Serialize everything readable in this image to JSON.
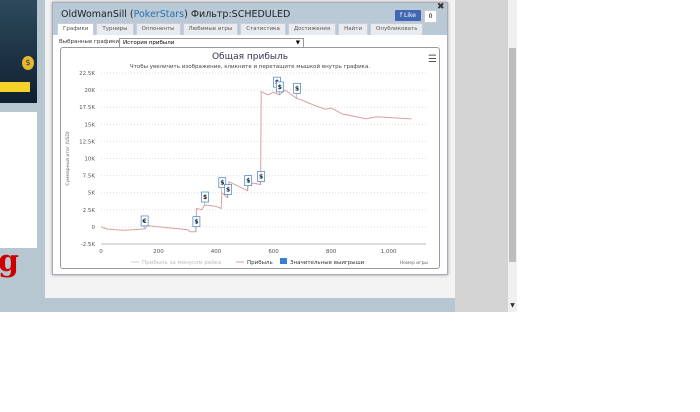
{
  "modal": {
    "user": "OldWomanSill",
    "site": "PokerStars",
    "filter": "Фильтр:SCHEDULED",
    "fb_like": "Like",
    "fb_count": "0"
  },
  "tabs": [
    "Графики",
    "Турниры",
    "Оппоненты",
    "Любимые игры",
    "Статистика",
    "Достижения",
    "Найти",
    "Опубликовать"
  ],
  "selector": {
    "label": "Выбранные графики:",
    "value": "История прибыли"
  },
  "chart_data": {
    "type": "line",
    "title": "Общая прибыль",
    "subtitle": "Чтобы увеличить изображение, кликните и перетащите мышкой внутрь графика.",
    "xlabel": "Номер игры",
    "ylabel": "Суммарный итог (USD)",
    "xlim": [
      0,
      1130
    ],
    "ylim": [
      -2500,
      22500
    ],
    "xticks": [
      "0",
      "200",
      "400",
      "600",
      "800",
      "1,000"
    ],
    "xtick_values": [
      0,
      200,
      400,
      600,
      800,
      1000
    ],
    "yticks": [
      "22.5K",
      "20K",
      "17.5K",
      "15K",
      "12.5K",
      "10K",
      "7.5K",
      "5K",
      "2.5K",
      "0",
      "-2.5K"
    ],
    "ytick_values": [
      22500,
      20000,
      17500,
      15000,
      12500,
      10000,
      7500,
      5000,
      2500,
      0,
      -2500
    ],
    "grid": true,
    "legend_position": "bottom",
    "legend": [
      "Прибыль за минусом рейка",
      "Прибыль",
      "Значительные выигрыши"
    ],
    "colors": {
      "profit": "#d9a0a0",
      "rake": "#cccccc",
      "flags": "#3a7fd5"
    },
    "series": [
      {
        "name": "Прибыль",
        "x": [
          0,
          20,
          80,
          150,
          155,
          160,
          200,
          300,
          310,
          330,
          332,
          350,
          360,
          400,
          418,
          420,
          440,
          445,
          460,
          500,
          510,
          512,
          555,
          557,
          580,
          600,
          620,
          640,
          680,
          700,
          740,
          780,
          800,
          840,
          900,
          920,
          960,
          1000,
          1080
        ],
        "y": [
          0,
          -300,
          -500,
          -300,
          -200,
          200,
          0,
          -400,
          -700,
          -700,
          2700,
          2500,
          3200,
          3000,
          2700,
          5000,
          4300,
          6600,
          6300,
          5500,
          5300,
          6500,
          6200,
          19800,
          19300,
          19700,
          19300,
          20000,
          18800,
          18500,
          17800,
          17200,
          17400,
          16500,
          16000,
          15800,
          16100,
          16000,
          15800
        ]
      }
    ],
    "flags": [
      {
        "x": 150,
        "label": "€"
      },
      {
        "x": 330,
        "label": "$"
      },
      {
        "x": 360,
        "label": "$"
      },
      {
        "x": 420,
        "label": "$"
      },
      {
        "x": 440,
        "label": "$"
      },
      {
        "x": 510,
        "label": "$"
      },
      {
        "x": 555,
        "label": "$"
      },
      {
        "x": 610,
        "label": "$"
      },
      {
        "x": 620,
        "label": "$"
      },
      {
        "x": 680,
        "label": "$"
      }
    ]
  }
}
